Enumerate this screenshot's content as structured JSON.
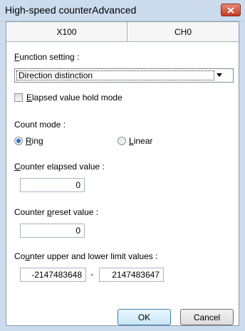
{
  "window": {
    "title": "High-speed counterAdvanced"
  },
  "tabs": [
    {
      "label": "X100"
    },
    {
      "label": "CH0"
    }
  ],
  "function_setting": {
    "label_underline": "F",
    "label_rest": "unction setting :",
    "selected_value": "Direction distinction"
  },
  "elapsed_hold": {
    "underline": "E",
    "rest": "lapsed value hold mode",
    "checked": false
  },
  "count_mode": {
    "label": "Count mode :",
    "options": [
      {
        "underline": "R",
        "rest": "ing",
        "selected": true
      },
      {
        "underline": "L",
        "rest": "inear",
        "selected": false
      }
    ]
  },
  "counter_elapsed": {
    "underline": "C",
    "rest": "ounter elapsed value :",
    "value": "0"
  },
  "counter_preset": {
    "prefix": "Counter ",
    "underline": "p",
    "rest": "reset value :",
    "value": "0"
  },
  "limits": {
    "prefix": "Co",
    "underline": "u",
    "rest": "nter upper and lower limit values :",
    "lower": "-2147483648",
    "separator": "-",
    "upper": "2147483647"
  },
  "buttons": {
    "ok": "OK",
    "cancel": "Cancel"
  },
  "colors": {
    "title_bar": "#ccdcee",
    "close_button": "#c53a22",
    "radio_selected": "#2b6fd6"
  }
}
